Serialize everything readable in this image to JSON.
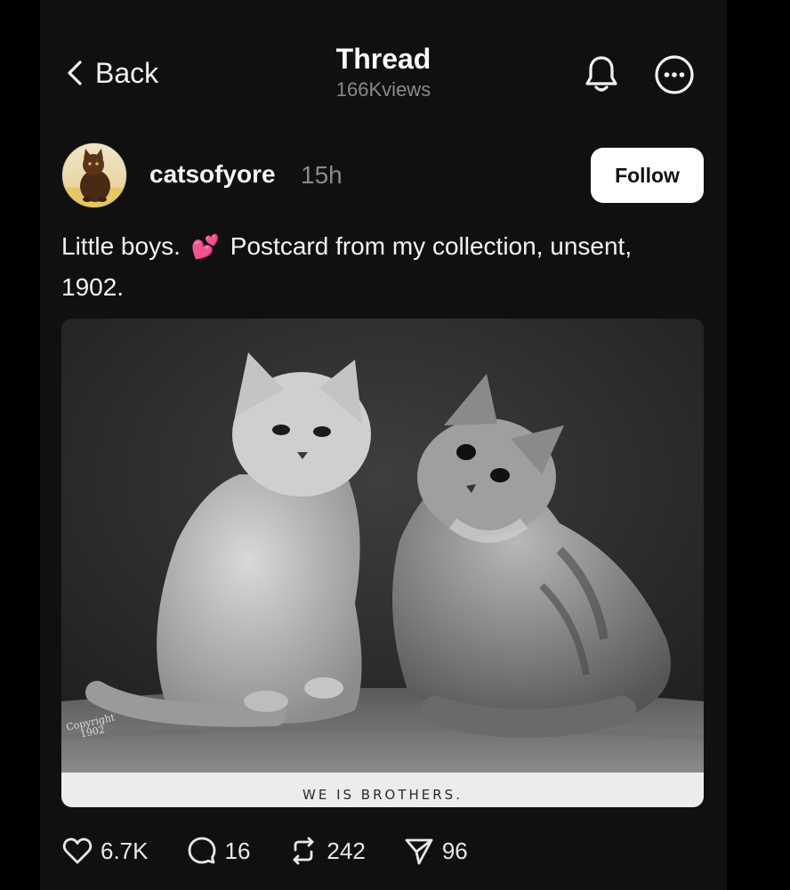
{
  "header": {
    "back_label": "Back",
    "title": "Thread",
    "subtitle": "166Kviews",
    "icons": [
      "chevron-left-icon",
      "bell-icon",
      "more-options-icon"
    ]
  },
  "post": {
    "username": "catsofyore",
    "time": "15h",
    "follow_label": "Follow",
    "caption_before": "Little boys.",
    "caption_emoji": "💕",
    "caption_after": "Postcard from my collection, unsent, 1902.",
    "image": {
      "caption": "WE IS BROTHERS.",
      "copyright_line1": "Copyright",
      "copyright_line2": "1902"
    }
  },
  "actions": {
    "likes": "6.7K",
    "replies": "16",
    "reposts": "242",
    "shares": "96",
    "icons": [
      "heart-icon",
      "comment-icon",
      "repost-icon",
      "send-icon"
    ]
  },
  "colors": {
    "background": "#101010",
    "text": "#f3f3f3",
    "muted": "#8a8a8a",
    "follow_bg": "#ffffff"
  }
}
